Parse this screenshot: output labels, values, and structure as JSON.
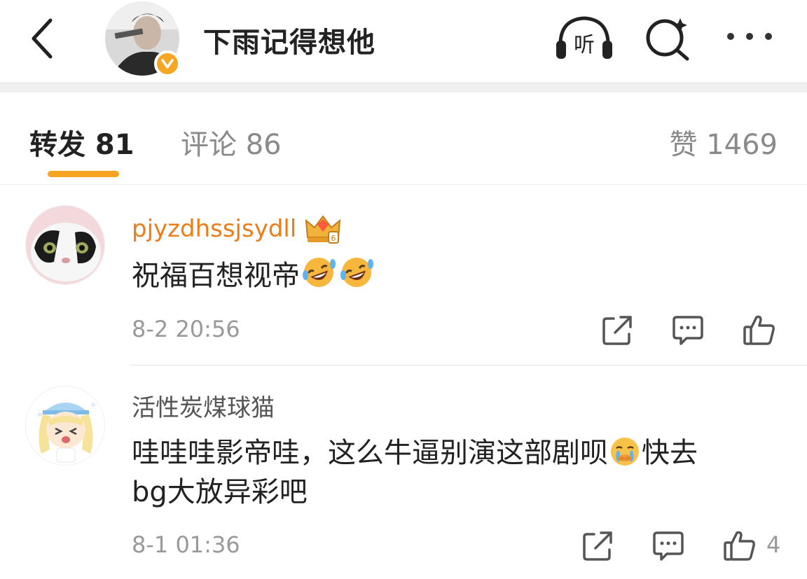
{
  "header": {
    "title": "下雨记得想他",
    "listen_label": "听"
  },
  "tabs": {
    "repost": "转发 81",
    "comment": "评论 86",
    "like": "赞 1469"
  },
  "comments": [
    {
      "username": "pjyzdhssjsydll",
      "text": "祝福百想视帝",
      "emojis": [
        "rofl-emoji",
        "rofl-emoji"
      ],
      "time": "8-2 20:56",
      "like_count": ""
    },
    {
      "username": "活性炭煤球猫",
      "text_line1": "哇哇哇影帝哇，这么牛逼别演这部剧呗",
      "text_line1_end": "快去",
      "text_line2": "bg大放异彩吧",
      "emoji": "crying-emoji",
      "time": "8-1 01:36",
      "like_count": "4"
    }
  ],
  "colors": {
    "accent": "#f7a420",
    "vip_name": "#ed7d18",
    "muted": "#999999"
  }
}
